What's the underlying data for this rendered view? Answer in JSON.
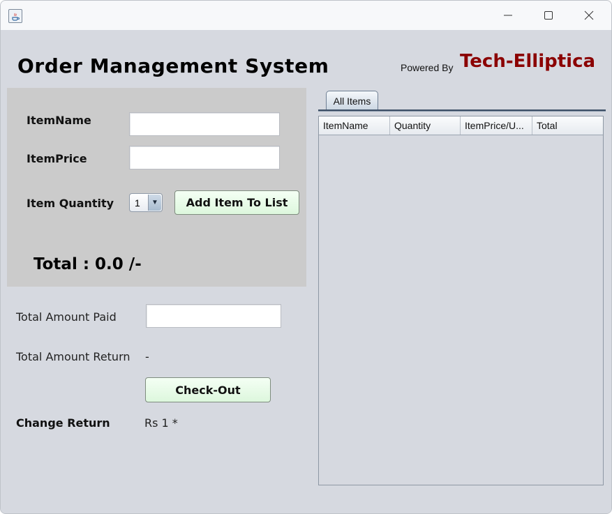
{
  "window": {
    "minimize_icon": "minimize-icon",
    "maximize_icon": "maximize-icon",
    "close_icon": "close-icon",
    "app_icon": "java-icon"
  },
  "header": {
    "title": "Order Management System",
    "powered_by": "Powered By",
    "brand": "Tech-Elliptica",
    "brand_color": "#8b0000"
  },
  "item_entry": {
    "item_name_label": "ItemName",
    "item_name_value": "",
    "item_price_label": "ItemPrice",
    "item_price_value": "",
    "item_quantity_label": "Item Quantity",
    "quantity_selected": "1",
    "add_button_label": "Add Item To List",
    "total_label": "Total : 0.0 /-"
  },
  "payment": {
    "amount_paid_label": "Total Amount Paid",
    "amount_paid_value": "",
    "amount_return_label": "Total Amount Return",
    "amount_return_value": "-",
    "checkout_label": "Check-Out",
    "change_return_label": "Change Return",
    "change_return_value": "Rs 1 *"
  },
  "items_panel": {
    "tab_label": "All Items",
    "columns": [
      "ItemName",
      "Quantity",
      "ItemPrice/U...",
      "Total"
    ],
    "rows": []
  },
  "colors": {
    "button_bg": "#ddf7dd",
    "panel_bg": "#cbcbcb",
    "window_bg": "#d6d9e0"
  }
}
